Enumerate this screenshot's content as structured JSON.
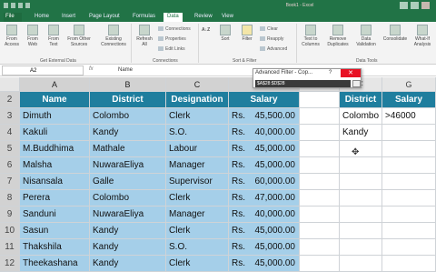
{
  "window": {
    "title": "Book1 - Excel"
  },
  "tabs": [
    "File",
    "Home",
    "Insert",
    "Page Layout",
    "Formulas",
    "Data",
    "Review",
    "View"
  ],
  "active_tab": "Data",
  "ribbon": {
    "get_external": [
      "From Access",
      "From Web",
      "From Text",
      "From Other Sources",
      "Existing Connections"
    ],
    "get_external_label": "Get External Data",
    "refresh": "Refresh All",
    "connections_items": [
      "Connections",
      "Properties",
      "Edit Links"
    ],
    "connections_label": "Connections",
    "sort_az": "A↓Z",
    "sort": "Sort",
    "filter": "Filter",
    "filter_items": [
      "Clear",
      "Reapply",
      "Advanced"
    ],
    "sort_filter_label": "Sort & Filter",
    "data_tools": [
      "Text to Columns",
      "Remove Duplicates",
      "Data Validation",
      "Consolidate",
      "What-If Analysis"
    ],
    "data_tools_label": "Data Tools"
  },
  "formula_bar": {
    "name_box": "A2",
    "fx": "fx",
    "formula": "Name"
  },
  "columns": [
    "A",
    "B",
    "C",
    "D",
    "E",
    "F",
    "G"
  ],
  "headers": {
    "name": "Name",
    "district": "District",
    "designation": "Designation",
    "salary": "Salary"
  },
  "rows": [
    {
      "n": "3",
      "name": "Dimuth",
      "district": "Colombo",
      "designation": "Clerk",
      "cur": "Rs.",
      "salary": "45,500.00"
    },
    {
      "n": "4",
      "name": "Kakuli",
      "district": "Kandy",
      "designation": "S.O.",
      "cur": "Rs.",
      "salary": "40,000.00"
    },
    {
      "n": "5",
      "name": "M.Buddhima",
      "district": "Mathale",
      "designation": "Labour",
      "cur": "Rs.",
      "salary": "45,000.00"
    },
    {
      "n": "6",
      "name": "Malsha",
      "district": "NuwaraEliya",
      "designation": "Manager",
      "cur": "Rs.",
      "salary": "45,000.00"
    },
    {
      "n": "7",
      "name": "Nisansala",
      "district": "Galle",
      "designation": "Supervisor",
      "cur": "Rs.",
      "salary": "60,000.00"
    },
    {
      "n": "8",
      "name": "Perera",
      "district": "Colombo",
      "designation": "Clerk",
      "cur": "Rs.",
      "salary": "47,000.00"
    },
    {
      "n": "9",
      "name": "Sanduni",
      "district": "NuwaraEliya",
      "designation": "Manager",
      "cur": "Rs.",
      "salary": "40,000.00"
    },
    {
      "n": "10",
      "name": "Sasun",
      "district": "Kandy",
      "designation": "Clerk",
      "cur": "Rs.",
      "salary": "45,000.00"
    },
    {
      "n": "11",
      "name": "Thakshila",
      "district": "Kandy",
      "designation": "S.O.",
      "cur": "Rs.",
      "salary": "45,000.00"
    },
    {
      "n": "12",
      "name": "Theekashana",
      "district": "Kandy",
      "designation": "Clerk",
      "cur": "Rs.",
      "salary": "45,000.00"
    }
  ],
  "criteria": {
    "h1": "District",
    "h2": "Salary",
    "r1c1": "Colombo",
    "r1c2": ">46000",
    "r2c1": "Kandy"
  },
  "dialog": {
    "title": "Advanced Filter - Cop...",
    "help": "?",
    "close": "✕",
    "range": "$A$28:$D$28"
  },
  "colors": {
    "header_fill": "#1f7e9e",
    "data_fill": "#a5cfe9",
    "excel_green": "#217346"
  }
}
